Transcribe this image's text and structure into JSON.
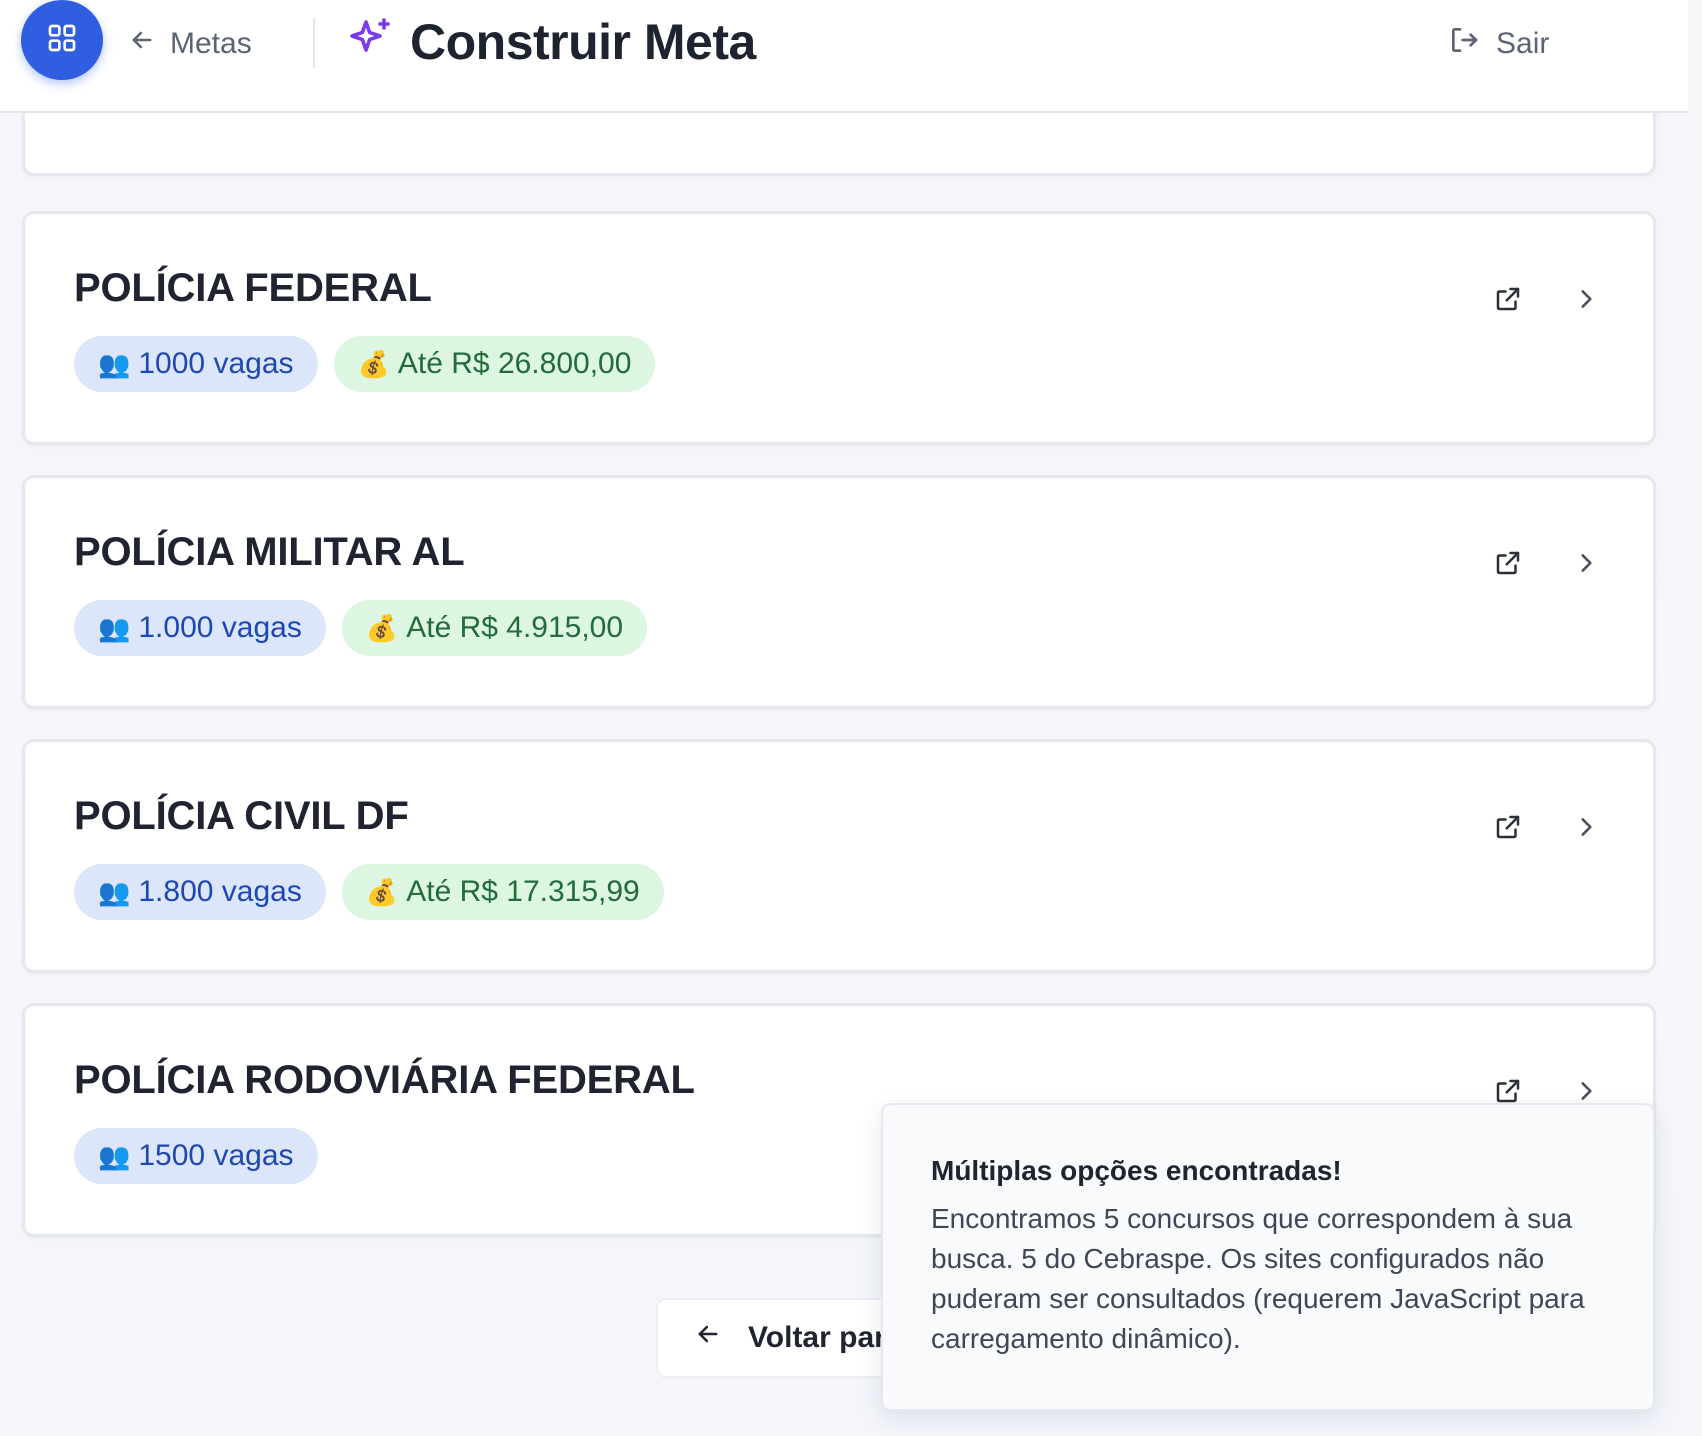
{
  "header": {
    "back_label": "Metas",
    "title": "Construir Meta",
    "logout_label": "Sair"
  },
  "cards": [
    {
      "title": "POLÍCIA FEDERAL",
      "vagas": "1000 vagas",
      "salario": "Até R$ 26.800,00"
    },
    {
      "title": "POLÍCIA MILITAR AL",
      "vagas": "1.000 vagas",
      "salario": "Até R$ 4.915,00"
    },
    {
      "title": "POLÍCIA CIVIL DF",
      "vagas": "1.800 vagas",
      "salario": "Até R$ 17.315,99"
    },
    {
      "title": "POLÍCIA RODOVIÁRIA FEDERAL",
      "vagas": "1500 vagas"
    }
  ],
  "chip_icons": {
    "vagas": "👥",
    "salario": "💰"
  },
  "back_button_label": "Voltar par",
  "toast": {
    "title": "Múltiplas opções encontradas!",
    "body": "Encontramos 5 concursos que correspondem à sua busca. 5 do Cebraspe. Os sites configurados não puderam ser consultados (requerem JavaScript para carregamento dinâmico)."
  },
  "colors": {
    "primary": "#2f5fe0",
    "accent_purple": "#7c3aed",
    "chip_blue_bg": "#dbe6fb",
    "chip_green_bg": "#dcf6e2"
  }
}
